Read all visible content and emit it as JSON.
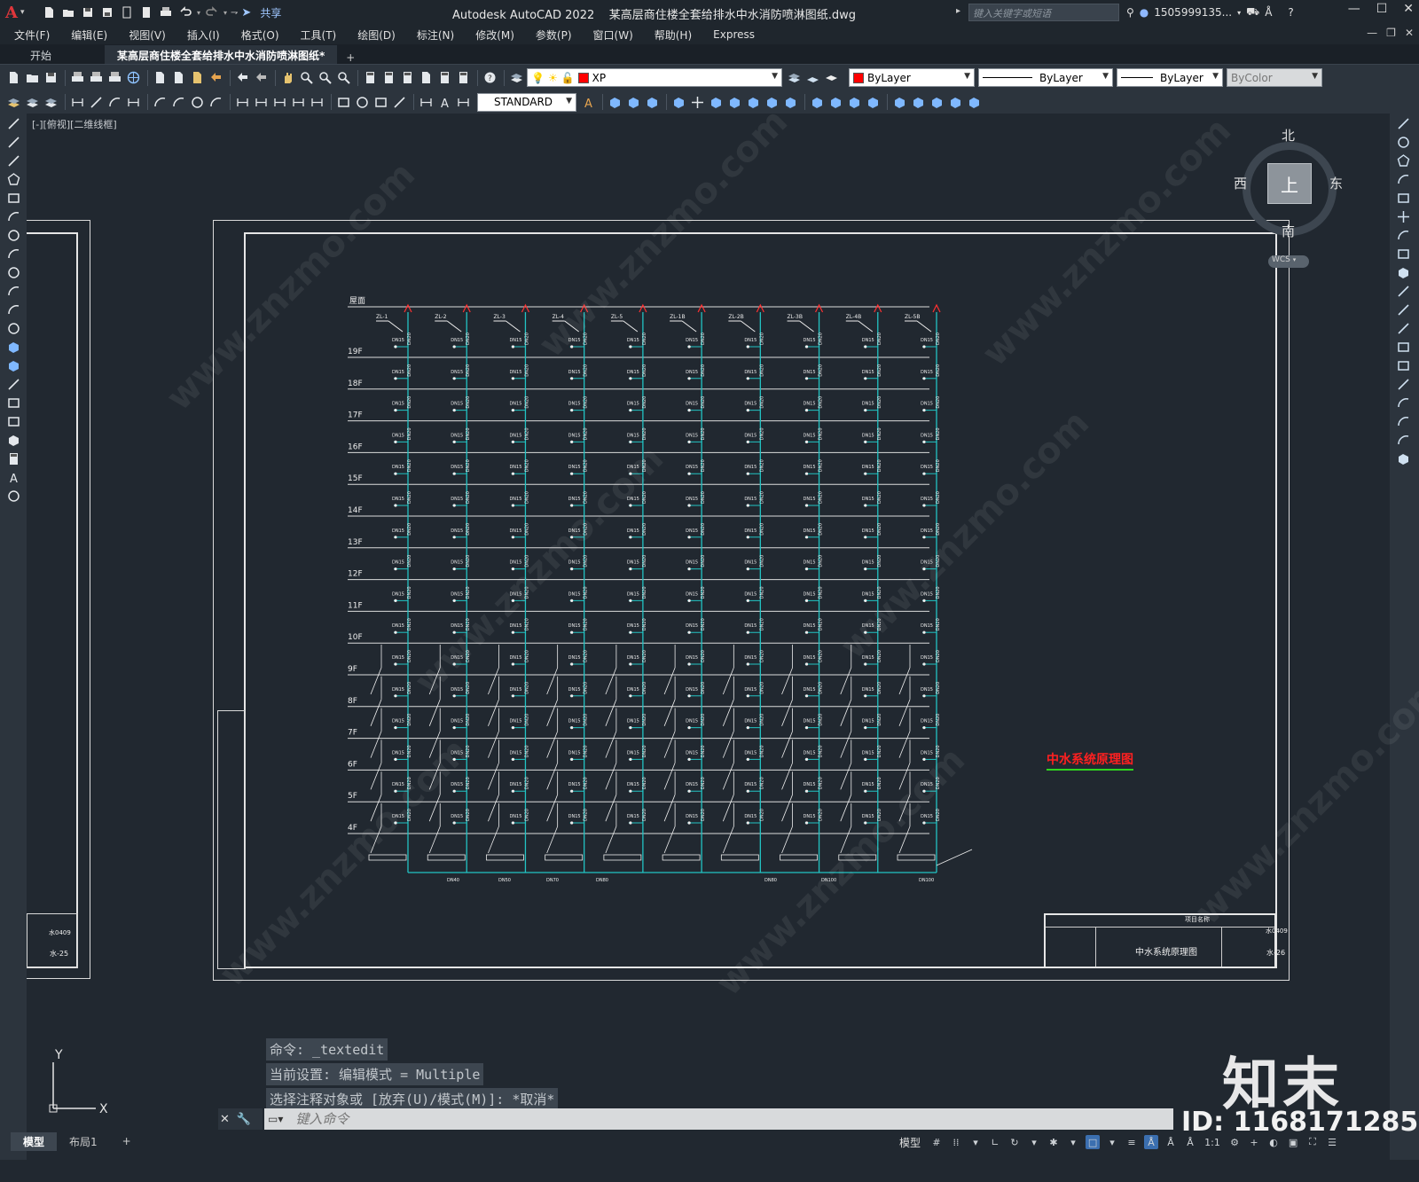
{
  "app": {
    "title": "Autodesk AutoCAD 2022",
    "document": "某高层商住楼全套给排水中水消防喷淋图纸.dwg",
    "share_label": "共享",
    "search_placeholder": "键入关键字或短语",
    "user": "1505999135...",
    "window_controls": [
      "—",
      "☐",
      "✕"
    ]
  },
  "menu": [
    "文件(F)",
    "编辑(E)",
    "视图(V)",
    "插入(I)",
    "格式(O)",
    "工具(T)",
    "绘图(D)",
    "标注(N)",
    "修改(M)",
    "参数(P)",
    "窗口(W)",
    "帮助(H)",
    "Express"
  ],
  "doc_tabs": [
    {
      "label": "开始",
      "active": false
    },
    {
      "label": "某高层商住楼全套给排水中水消防喷淋图纸*",
      "active": true
    }
  ],
  "toolbar": {
    "layer": "XP",
    "layer_color": "#ff0000",
    "color": "ByLayer",
    "linetype": "ByLayer",
    "lineweight": "ByLayer",
    "plotstyle": "ByColor",
    "textstyle": "STANDARD"
  },
  "viewport": {
    "label": "[-][俯视][二维线框]",
    "compass": {
      "top": "上",
      "north": "北",
      "south": "南",
      "east": "东",
      "west": "西"
    },
    "wcs": "WCS"
  },
  "drawing": {
    "title": "中水系统原理图",
    "roof_label": "屋面",
    "floors": [
      "19F",
      "18F",
      "17F",
      "16F",
      "15F",
      "14F",
      "13F",
      "12F",
      "11F",
      "10F",
      "9F",
      "8F",
      "7F",
      "6F",
      "5F",
      "4F"
    ],
    "risers": [
      "ZL-1",
      "ZL-2",
      "ZL-3",
      "ZL-4",
      "ZL-5",
      "ZL-1B",
      "ZL-2B",
      "ZL-3B",
      "ZL-4B",
      "ZL-5B"
    ],
    "branch_size": "DN15",
    "main_size": "DN20",
    "bottom_sizes": [
      "DN40",
      "DN50",
      "DN70",
      "DN80",
      "DN80",
      "DN100",
      "DN100"
    ],
    "title_block": {
      "name": "中水系统原理图",
      "code": "水0409",
      "number": "水-26",
      "project": "项目名称"
    },
    "left_title_block": {
      "code": "水0409",
      "number": "水-25"
    }
  },
  "command": {
    "history": [
      "命令: _textedit",
      "当前设置: 编辑模式 = Multiple",
      "选择注释对象或 [放弃(U)/模式(M)]: *取消*"
    ],
    "placeholder": "键入命令"
  },
  "layout_tabs": [
    "模型",
    "布局1"
  ],
  "status": {
    "model": "模型",
    "scale": "1:1"
  },
  "watermark": {
    "brand": "知末",
    "id": "ID: 1168171285",
    "url": "www.znzmo.com"
  }
}
